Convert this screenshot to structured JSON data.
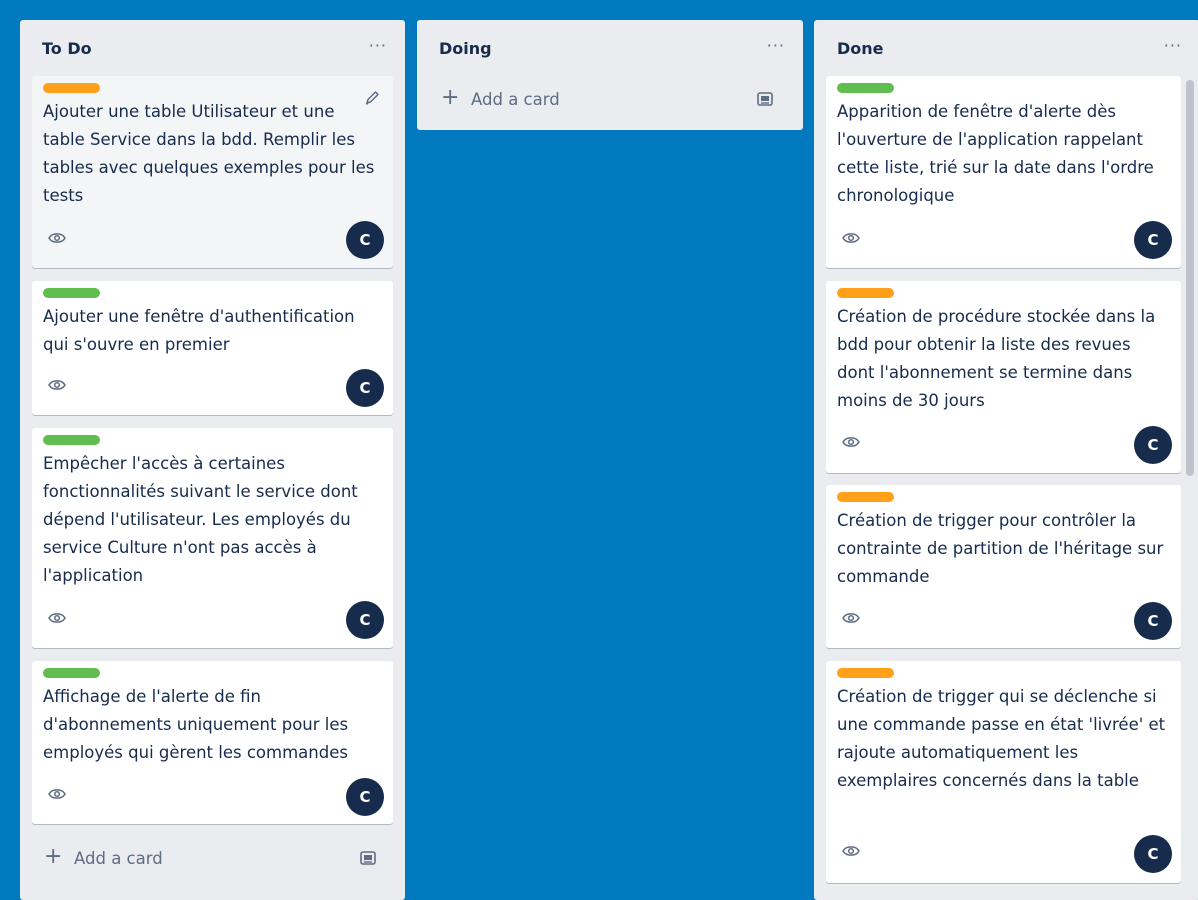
{
  "colors": {
    "board_bg": "#0079bf",
    "label_orange": "#ff9f1a",
    "label_green": "#61bd4f"
  },
  "icons": {
    "more": "more-horizontal-icon",
    "eye": "eye-icon",
    "edit": "pencil-icon",
    "add": "plus-icon",
    "template": "card-template-icon"
  },
  "lists": {
    "todo": {
      "title": "To Do",
      "more": "···",
      "add_card": "Add a card",
      "cards": [
        {
          "label_color": "orange",
          "title": "Ajouter une table Utilisateur et une table Service dans la bdd. Remplir les tables avec quelques exemples pour les tests",
          "member": "C"
        },
        {
          "label_color": "green",
          "title": "Ajouter une fenêtre d'authentification qui s'ouvre en premier",
          "member": "C"
        },
        {
          "label_color": "green",
          "title": "Empêcher l'accès à certaines fonctionnalités suivant le service dont dépend l'utilisateur. Les employés du service Culture n'ont pas accès à l'application",
          "member": "C"
        },
        {
          "label_color": "green",
          "title": "Affichage de l'alerte de fin d'abonnements uniquement pour les employés qui gèrent les commandes",
          "member": "C"
        }
      ]
    },
    "doing": {
      "title": "Doing",
      "more": "···",
      "add_card": "Add a card"
    },
    "done": {
      "title": "Done",
      "more": "···",
      "cards": [
        {
          "label_color": "green",
          "title": "Apparition de fenêtre d'alerte dès l'ouverture de l'application rappelant cette liste, trié sur la date dans l'ordre chronologique",
          "member": "C"
        },
        {
          "label_color": "orange",
          "title": "Création de procédure stockée dans la bdd pour obtenir la liste des revues dont l'abonnement se termine dans moins de 30 jours",
          "member": "C"
        },
        {
          "label_color": "orange",
          "title": "Création de trigger pour contrôler la contrainte de partition de l'héritage sur commande",
          "member": "C"
        },
        {
          "label_color": "orange",
          "title": "Création de trigger qui se déclenche si une commande passe en état 'livrée' et rajoute automatiquement les exemplaires concernés dans la table",
          "member": "C"
        }
      ]
    }
  }
}
